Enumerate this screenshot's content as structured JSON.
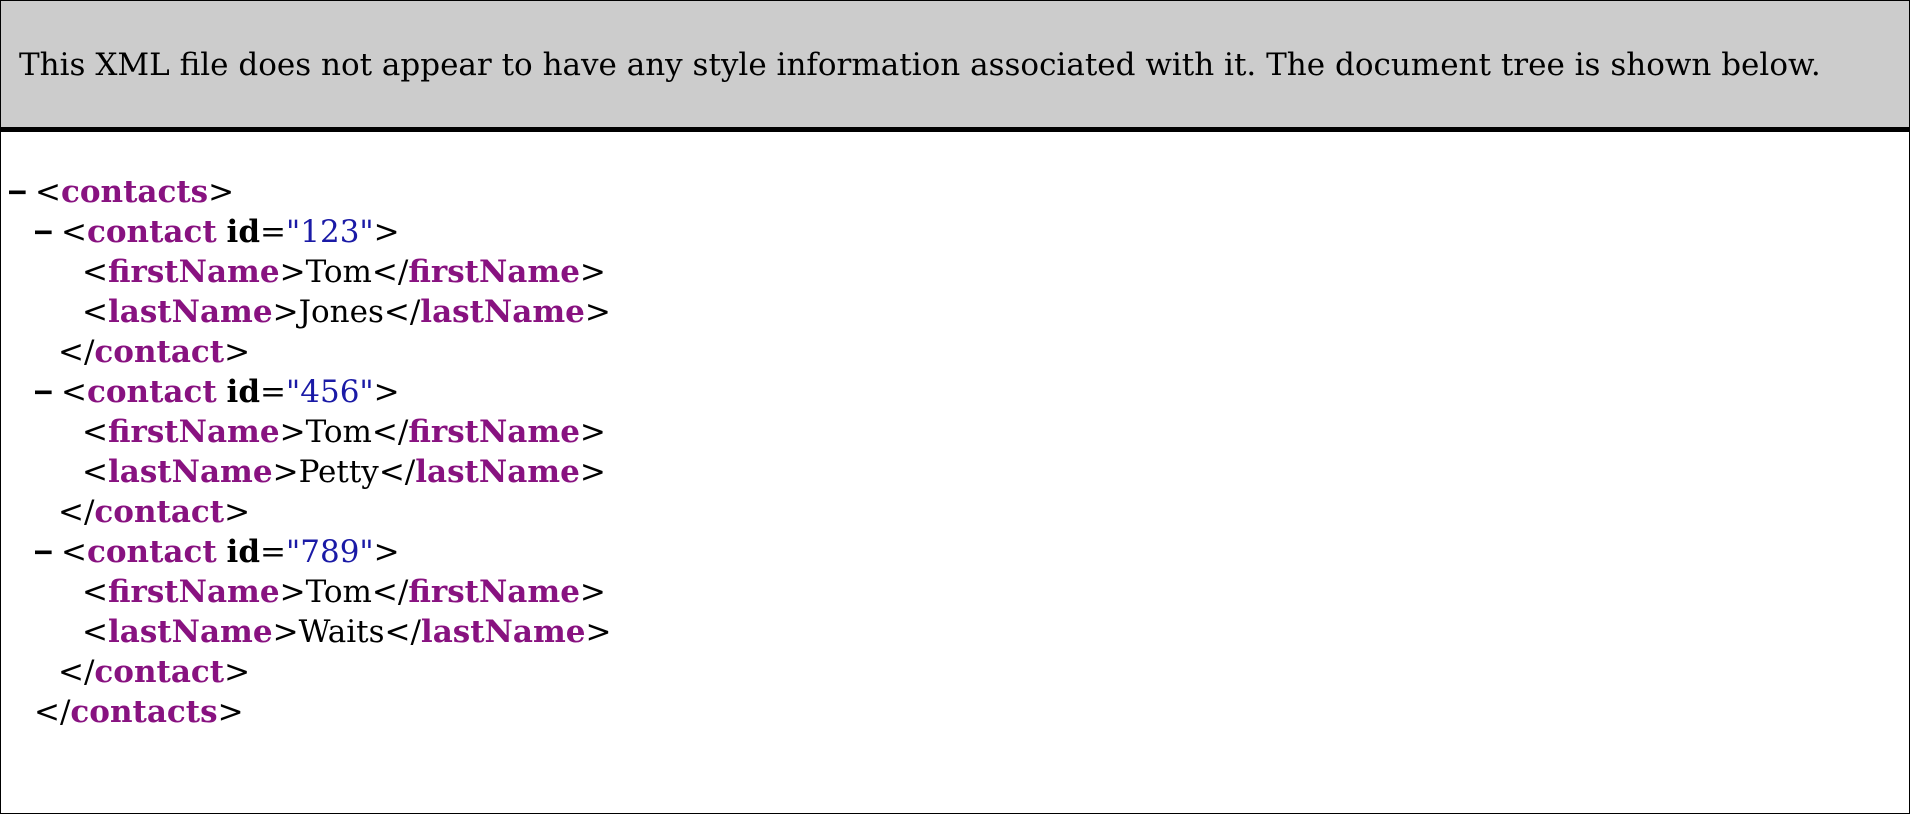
{
  "header": {
    "message": "This XML file does not appear to have any style information associated with it. The document tree is shown below."
  },
  "tree": {
    "toggle_symbol": "−",
    "root_tag": "contacts",
    "contact_tag": "contact",
    "attr_name": "id",
    "first_tag": "firstName",
    "last_tag": "lastName",
    "contacts": [
      {
        "id": "\"123\"",
        "first": "Tom",
        "last": "Jones"
      },
      {
        "id": "\"456\"",
        "first": "Tom",
        "last": "Petty"
      },
      {
        "id": "\"789\"",
        "first": "Tom",
        "last": "Waits"
      }
    ]
  },
  "colors": {
    "tag": "#881280",
    "attr_value": "#1a1aa6",
    "header_bg": "#cccccc"
  }
}
